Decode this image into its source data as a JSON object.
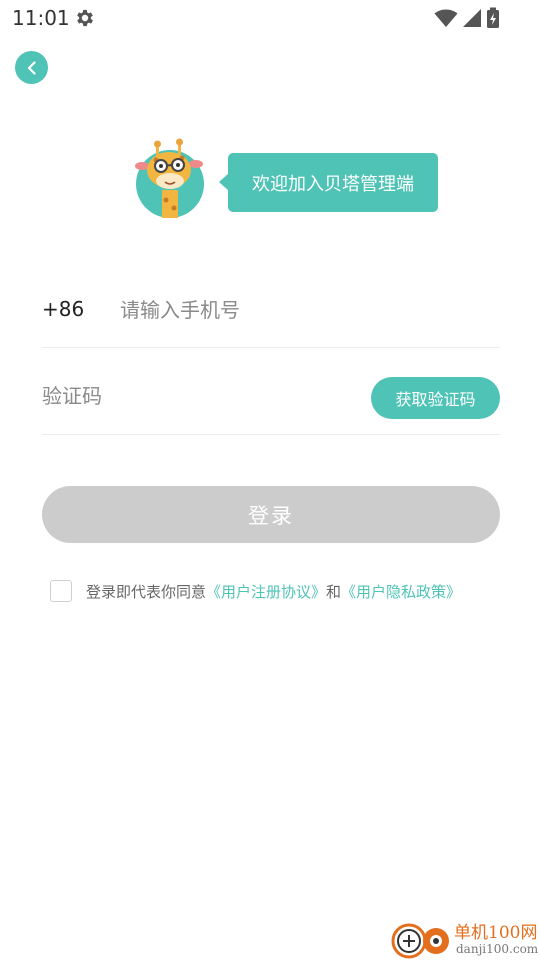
{
  "status_bar": {
    "time": "11:01",
    "icons": [
      "settings-gear-icon",
      "wifi-icon",
      "signal-icon",
      "battery-charging-icon"
    ]
  },
  "header": {
    "back_icon": "chevron-left-icon"
  },
  "welcome": {
    "mascot": "giraffe-mascot",
    "message": "欢迎加入贝塔管理端"
  },
  "form": {
    "country_code": "+86",
    "phone_placeholder": "请输入手机号",
    "phone_value": "",
    "code_placeholder": "验证码",
    "code_value": "",
    "get_code_label": "获取验证码",
    "login_label": "登录"
  },
  "agreement": {
    "checked": false,
    "prefix": "登录即代表你同意",
    "user_agreement": "《用户注册协议》",
    "conjunction": "和",
    "privacy_policy": "《用户隐私政策》"
  },
  "watermark": {
    "title": "单机100网",
    "url": "danji100.com"
  },
  "colors": {
    "accent": "#4fc3b6",
    "disabled_button": "#cccccc",
    "watermark_orange": "#e36f1e"
  }
}
